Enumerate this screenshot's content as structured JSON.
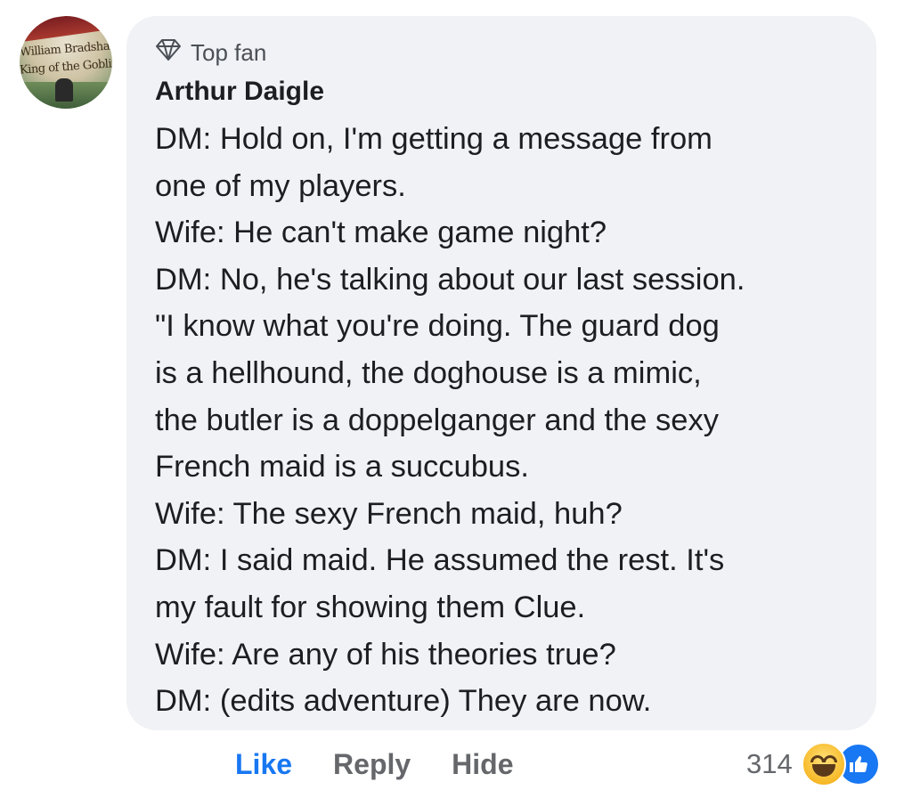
{
  "avatar": {
    "line1": "William Bradshaw",
    "line2": "King of the Goblins"
  },
  "badge": {
    "label": "Top fan",
    "icon": "diamond-icon"
  },
  "author": "Arthur Daigle",
  "comment_lines": [
    "DM: Hold on, I'm getting a message from",
    "one of my players.",
    "Wife: He can't make game night?",
    "DM: No, he's talking about our last session.",
    "\"I know what you're doing.  The guard dog",
    "is a hellhound, the doghouse is a mimic,",
    "the butler is a doppelganger and the sexy",
    "French maid is a succubus.",
    "Wife: The sexy French maid, huh?",
    "DM: I said maid.  He assumed the rest.  It's",
    "my fault for showing them Clue.",
    "Wife: Are any of his theories true?",
    "DM: (edits adventure) They are now."
  ],
  "actions": {
    "like": "Like",
    "reply": "Reply",
    "hide": "Hide"
  },
  "reactions": {
    "count": "314",
    "icons": [
      "haha-icon",
      "like-icon"
    ]
  },
  "colors": {
    "bubble": "#f0f2f5",
    "like": "#1877f2",
    "muted": "#65676b",
    "text": "#1c1e21"
  }
}
